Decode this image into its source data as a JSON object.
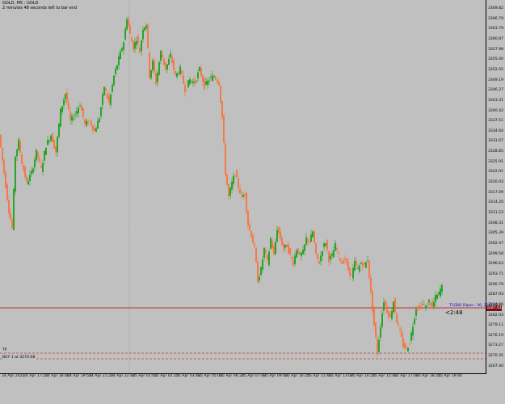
{
  "header": {
    "symbol_line": "GOLD, M5 : GOLD",
    "timer_line": "2 minutes 48 seconds left to bar end"
  },
  "price_axis": {
    "labels": [
      "3369.82",
      "3366.79",
      "3363.79",
      "3360.87",
      "3357.98",
      "3355.00",
      "3352.05",
      "3349.19",
      "3346.27",
      "3343.31",
      "3340.42",
      "3337.51",
      "3334.64",
      "3331.67",
      "3328.85",
      "3325.91",
      "3322.91",
      "3320.03",
      "3317.09",
      "3314.20",
      "3311.23",
      "3308.31",
      "3305.39",
      "3302.47",
      "3299.58",
      "3296.63",
      "3293.71",
      "3290.79",
      "3287.93",
      "3284.96",
      "3282.03",
      "3279.11",
      "3276.19",
      "3273.27",
      "3270.35",
      "3267.40"
    ]
  },
  "time_axis": {
    "labels": [
      "24 Apr 2025",
      "24 Apr 17:25",
      "24 Apr 18:40",
      "24 Apr 19:55",
      "24 Apr 21:25",
      "24 Apr 22:40",
      "25 Apr 01:05",
      "25 Apr 02:25",
      "25 Apr 03:40",
      "25 Apr 05:00",
      "25 Apr 06:25",
      "25 Apr 07:40",
      "25 Apr 09:00",
      "25 Apr 10:25",
      "25 Apr 11:40",
      "25 Apr 13:00",
      "25 Apr 14:25",
      "25 Apr 15:40",
      "25 Apr 17:00",
      "25 Apr 18:25",
      "25 Apr 19:40"
    ]
  },
  "price_line": {
    "badge": "3287.61",
    "label": "T1GBO [Open : 36, 3287.61]",
    "countdown": "<2:48",
    "color": "#c00000"
  },
  "levels": {
    "tp_label": "TP",
    "sl_label": "SL",
    "buy_label": "BUY 1 at 3270.08",
    "dash_color": "#c00000"
  },
  "colors": {
    "background": "#c0c0c0",
    "bull": "#00a000",
    "bear": "#ff6a2a"
  },
  "chart_data": {
    "type": "candlestick",
    "symbol": "GOLD",
    "timeframe": "M5",
    "y_range": [
      3264,
      3372
    ],
    "path": [
      [
        0,
        3333
      ],
      [
        6,
        3322
      ],
      [
        12,
        3311
      ],
      [
        16,
        3306
      ],
      [
        20,
        3327
      ],
      [
        24,
        3331
      ],
      [
        28,
        3325
      ],
      [
        34,
        3319
      ],
      [
        40,
        3322
      ],
      [
        46,
        3328
      ],
      [
        52,
        3323
      ],
      [
        58,
        3330
      ],
      [
        64,
        3333
      ],
      [
        70,
        3328
      ],
      [
        76,
        3340
      ],
      [
        82,
        3345
      ],
      [
        88,
        3337
      ],
      [
        94,
        3339
      ],
      [
        100,
        3342
      ],
      [
        106,
        3336
      ],
      [
        112,
        3337
      ],
      [
        118,
        3334
      ],
      [
        124,
        3338
      ],
      [
        130,
        3347
      ],
      [
        136,
        3342
      ],
      [
        142,
        3350
      ],
      [
        148,
        3355
      ],
      [
        154,
        3360
      ],
      [
        158,
        3367
      ],
      [
        162,
        3362
      ],
      [
        166,
        3358
      ],
      [
        170,
        3361
      ],
      [
        174,
        3357
      ],
      [
        178,
        3364
      ],
      [
        182,
        3365
      ],
      [
        186,
        3350
      ],
      [
        190,
        3354
      ],
      [
        194,
        3348
      ],
      [
        200,
        3357
      ],
      [
        206,
        3352
      ],
      [
        212,
        3356
      ],
      [
        218,
        3350
      ],
      [
        224,
        3352
      ],
      [
        230,
        3346
      ],
      [
        236,
        3349
      ],
      [
        242,
        3348
      ],
      [
        248,
        3352
      ],
      [
        254,
        3347
      ],
      [
        260,
        3349
      ],
      [
        266,
        3350
      ],
      [
        272,
        3348
      ],
      [
        276,
        3338
      ],
      [
        280,
        3322
      ],
      [
        284,
        3315
      ],
      [
        288,
        3319
      ],
      [
        292,
        3322
      ],
      [
        296,
        3318
      ],
      [
        300,
        3315
      ],
      [
        304,
        3316
      ],
      [
        308,
        3307
      ],
      [
        312,
        3304
      ],
      [
        316,
        3300
      ],
      [
        320,
        3291
      ],
      [
        324,
        3294
      ],
      [
        328,
        3300
      ],
      [
        332,
        3296
      ],
      [
        336,
        3303
      ],
      [
        340,
        3298
      ],
      [
        344,
        3306
      ],
      [
        348,
        3303
      ],
      [
        352,
        3300
      ],
      [
        356,
        3301
      ],
      [
        360,
        3298
      ],
      [
        364,
        3296
      ],
      [
        368,
        3300
      ],
      [
        372,
        3298
      ],
      [
        376,
        3299
      ],
      [
        380,
        3303
      ],
      [
        384,
        3302
      ],
      [
        388,
        3305
      ],
      [
        392,
        3298
      ],
      [
        396,
        3296
      ],
      [
        400,
        3300
      ],
      [
        404,
        3302
      ],
      [
        408,
        3297
      ],
      [
        412,
        3298
      ],
      [
        416,
        3301
      ],
      [
        420,
        3298
      ],
      [
        424,
        3296
      ],
      [
        428,
        3297
      ],
      [
        432,
        3294
      ],
      [
        436,
        3292
      ],
      [
        440,
        3296
      ],
      [
        444,
        3294
      ],
      [
        448,
        3296
      ],
      [
        452,
        3295
      ],
      [
        456,
        3297
      ],
      [
        460,
        3287
      ],
      [
        464,
        3278
      ],
      [
        468,
        3270
      ],
      [
        472,
        3278
      ],
      [
        476,
        3285
      ],
      [
        480,
        3282
      ],
      [
        484,
        3280
      ],
      [
        488,
        3285
      ],
      [
        492,
        3279
      ],
      [
        496,
        3276
      ],
      [
        500,
        3272
      ],
      [
        504,
        3271
      ],
      [
        508,
        3273
      ],
      [
        512,
        3278
      ],
      [
        516,
        3283
      ],
      [
        520,
        3283
      ],
      [
        524,
        3284
      ],
      [
        528,
        3283
      ],
      [
        532,
        3285
      ],
      [
        536,
        3283
      ],
      [
        540,
        3286
      ],
      [
        544,
        3287
      ],
      [
        547,
        3289
      ]
    ]
  }
}
